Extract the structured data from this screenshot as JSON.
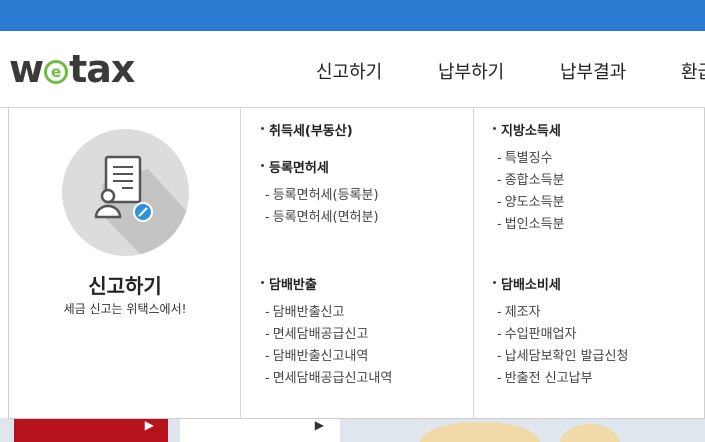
{
  "logo": {
    "pre": "w",
    "e": "e",
    "post": "tax"
  },
  "nav": {
    "items": [
      "신고하기",
      "납부하기",
      "납부결과",
      "환급"
    ]
  },
  "panel": {
    "title": "신고하기",
    "subtitle": "세금 신고는 위택스에서!",
    "icon": "document-user-pencil-icon",
    "col1": {
      "cat1": "취득세(부동산)",
      "cat2": "등록면허세",
      "cat2_items": [
        "등록면허세(등록분)",
        "등록면허세(면허분)"
      ],
      "cat3": "담배반출",
      "cat3_items": [
        "담배반출신고",
        "면세담배공급신고",
        "담배반출신고내역",
        "면세담배공급신고내역"
      ]
    },
    "col2": {
      "cat1": "지방소득세",
      "cat1_items": [
        "특별징수",
        "종합소득분",
        "양도소득분",
        "법인소득분"
      ],
      "cat2": "담배소비세",
      "cat2_items": [
        "제조자",
        "수입판매업자",
        "납세담보확인 발급신청",
        "반출전 신고납부"
      ]
    }
  },
  "colors": {
    "topbar": "#2a7ad2",
    "logo_accent": "#6cbf3a",
    "strip_red": "#b5121b",
    "icon_blue": "#2f8fe0"
  }
}
